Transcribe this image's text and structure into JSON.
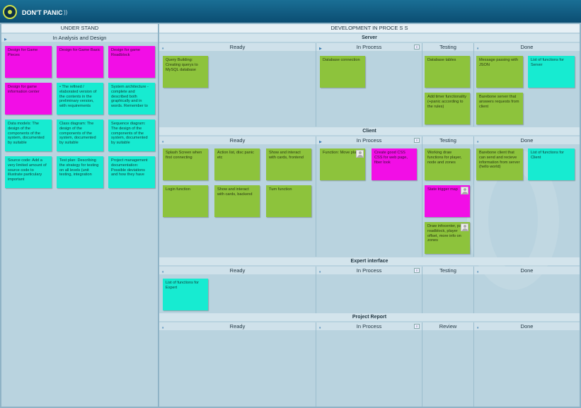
{
  "app": {
    "title": "DON'T PANIC",
    "rss_icon": "rss-icon"
  },
  "understand": {
    "header": "UNDER STAND",
    "subheader": "In Analysis and Design",
    "cards": [
      {
        "text": "Design for Game Pieces",
        "color": "magenta"
      },
      {
        "text": "Design for Game Basic",
        "color": "magenta"
      },
      {
        "text": "Design for game Roadblock",
        "color": "magenta"
      },
      {
        "text": "Design for game information center",
        "color": "magenta"
      },
      {
        "text": "• The refined / elaborated version of the contents in the preliminary version, with requirements",
        "color": "cyan"
      },
      {
        "text": "System architecture - complete and described both graphically and in words. Remember to",
        "color": "cyan"
      },
      {
        "text": "Data models: The design of the components of the system, documented by suitable",
        "color": "cyan"
      },
      {
        "text": "Class diagram: The design of the components of the system, documented by suitable",
        "color": "cyan"
      },
      {
        "text": "Sequence diagram: The design of the components of the system, documented by suitable",
        "color": "cyan"
      },
      {
        "text": "Source code: Add a very limited amount of source code to illustrate particulary important",
        "color": "cyan"
      },
      {
        "text": "Test plan: Describing the strategy for testing on all levels (unit testing, integration",
        "color": "cyan"
      },
      {
        "text": "Project management documentation: Possible deviations and how they have",
        "color": "cyan"
      }
    ]
  },
  "development": {
    "header": "DEVELOPMENT IN PROCE S S",
    "lanes": [
      {
        "name": "Server",
        "columns": [
          "Ready",
          "In Process",
          "Testing",
          "Done"
        ],
        "ready": [
          {
            "text": "Query Building: Creating querys to MySQL database",
            "color": "green"
          }
        ],
        "in_process": [
          {
            "text": "Database connection",
            "color": "green"
          }
        ],
        "testing": [
          {
            "text": "Database tables",
            "color": "green"
          },
          {
            "text": "Add timer functionality (+panic according to the rules)",
            "color": "green"
          }
        ],
        "done": [
          {
            "text": "Message passing with JSON",
            "color": "green"
          },
          {
            "text": "List of functions for Server",
            "color": "cyan"
          },
          {
            "text": "Barebone server that answers requests from client",
            "color": "green"
          }
        ]
      },
      {
        "name": "Client",
        "columns": [
          "Ready",
          "In Process",
          "Testing",
          "Done"
        ],
        "ready": [
          {
            "text": "Splash Screen when first connecting",
            "color": "green"
          },
          {
            "text": "Action list, disc panic etc",
            "color": "green"
          },
          {
            "text": "Show and interact with cards, frontend",
            "color": "green"
          },
          {
            "text": "Login function",
            "color": "green"
          },
          {
            "text": "Show and interact with cards, backend",
            "color": "green"
          },
          {
            "text": "Turn function",
            "color": "green"
          }
        ],
        "in_process": [
          {
            "text": "Function: Move player",
            "color": "green"
          },
          {
            "text": "Create good CSS CSS for web page, fiber look",
            "color": "magenta"
          }
        ],
        "testing": [
          {
            "text": "Working draw functions for player, node and zones",
            "color": "green"
          },
          {
            "text": "State trigger map",
            "color": "magenta"
          },
          {
            "text": "Draw infocenter, path, roadblock, player offset, more info on zones",
            "color": "green"
          }
        ],
        "done": [
          {
            "text": "Barebone client that can send and recieve information from server (hello world)",
            "color": "green"
          },
          {
            "text": "List of functions for Client",
            "color": "cyan"
          }
        ]
      },
      {
        "name": "Expert interface",
        "columns": [
          "Ready",
          "In Process",
          "Testing",
          "Done"
        ],
        "ready": [
          {
            "text": "List of functions for Expert",
            "color": "cyan"
          }
        ]
      },
      {
        "name": "Project Report",
        "columns": [
          "Ready",
          "In Process",
          "Review",
          "Done"
        ]
      }
    ]
  },
  "colors": {
    "green": "#8dc33c",
    "cyan": "#17ebd1",
    "magenta": "#f20ee6",
    "topbar": "#0b4d72"
  }
}
